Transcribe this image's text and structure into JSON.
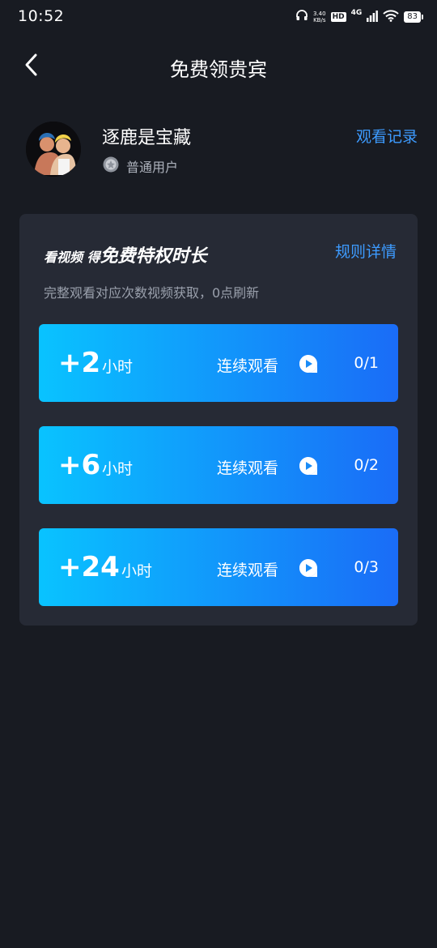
{
  "status_bar": {
    "time": "10:52",
    "net_speed_value": "3.40",
    "net_speed_unit": "KB/s",
    "hd": "HD",
    "network": "4G",
    "battery": "83"
  },
  "nav": {
    "title": "免费领贵宾"
  },
  "profile": {
    "username": "逐鹿是宝藏",
    "level": "普通用户",
    "watch_history": "观看记录"
  },
  "card": {
    "title_part1": "看视频 得",
    "title_part2": "免费特权时长",
    "rules_link": "规则详情",
    "description": "完整观看对应次数视频获取，0点刷新"
  },
  "rewards": [
    {
      "amount": "+2",
      "unit": "小时",
      "action": "连续观看",
      "progress": "0/1"
    },
    {
      "amount": "+6",
      "unit": "小时",
      "action": "连续观看",
      "progress": "0/2"
    },
    {
      "amount": "+24",
      "unit": "小时",
      "action": "连续观看",
      "progress": "0/3"
    }
  ],
  "colors": {
    "background": "#181b22",
    "card": "#262a35",
    "accent_link": "#3d9bff",
    "gradient_start": "#09c3ff",
    "gradient_end": "#1a6cf7"
  },
  "icons": {
    "back": "chevron-left-icon",
    "play": "play-circle-icon",
    "level_badge": "badge-icon"
  }
}
